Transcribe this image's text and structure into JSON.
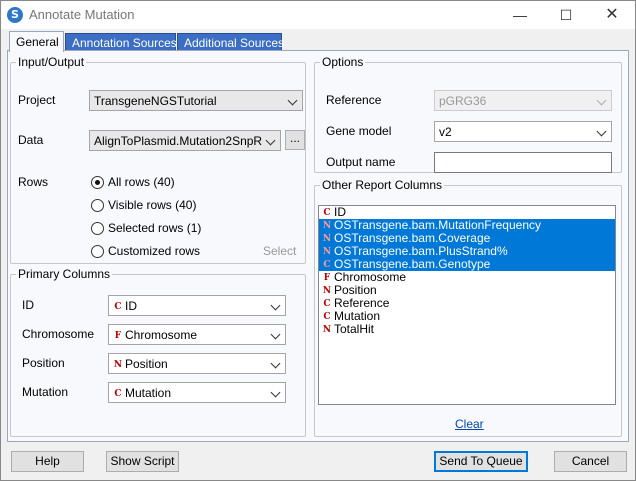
{
  "window": {
    "title": "Annotate Mutation",
    "minimize": "—",
    "maximize": "☐",
    "close": "✕"
  },
  "tabs": [
    {
      "label": "General"
    },
    {
      "label": "Annotation Sources"
    },
    {
      "label": "Additional Sources"
    }
  ],
  "input_output": {
    "legend": "Input/Output",
    "project_label": "Project",
    "project_value": "TransgeneNGSTutorial",
    "data_label": "Data",
    "data_value": "AlignToPlasmid.Mutation2SnpRepor",
    "data_browse": "...",
    "rows_label": "Rows",
    "rows_options": [
      "All rows (40)",
      "Visible rows (40)",
      "Selected rows (1)",
      "Customized rows"
    ],
    "rows_selected": "All rows (40)",
    "select_link": "Select"
  },
  "primary_columns": {
    "legend": "Primary Columns",
    "fields": [
      {
        "label": "ID",
        "icon": "C",
        "value": "ID"
      },
      {
        "label": "Chromosome",
        "icon": "F",
        "value": "Chromosome"
      },
      {
        "label": "Position",
        "icon": "N",
        "value": "Position"
      },
      {
        "label": "Mutation",
        "icon": "C",
        "value": "Mutation"
      }
    ]
  },
  "options": {
    "legend": "Options",
    "reference_label": "Reference",
    "reference_value": "pGRG36",
    "gene_model_label": "Gene model",
    "gene_model_value": "v2",
    "output_name_label": "Output name",
    "output_name_value": ""
  },
  "other_columns": {
    "legend": "Other Report Columns",
    "items": [
      {
        "icon": "C",
        "label": "ID",
        "selected": false
      },
      {
        "icon": "N",
        "label": "OSTransgene.bam.MutationFrequency",
        "selected": true
      },
      {
        "icon": "N",
        "label": "OSTransgene.bam.Coverage",
        "selected": true
      },
      {
        "icon": "N",
        "label": "OSTransgene.bam.PlusStrand%",
        "selected": true
      },
      {
        "icon": "C",
        "label": "OSTransgene.bam.Genotype",
        "selected": true
      },
      {
        "icon": "F",
        "label": "Chromosome",
        "selected": false
      },
      {
        "icon": "N",
        "label": "Position",
        "selected": false
      },
      {
        "icon": "C",
        "label": "Reference",
        "selected": false
      },
      {
        "icon": "C",
        "label": "Mutation",
        "selected": false
      },
      {
        "icon": "N",
        "label": "TotalHit",
        "selected": false
      }
    ],
    "clear_link": "Clear"
  },
  "buttons": {
    "help": "Help",
    "show_script": "Show Script",
    "send_to_queue": "Send To Queue",
    "cancel": "Cancel"
  }
}
